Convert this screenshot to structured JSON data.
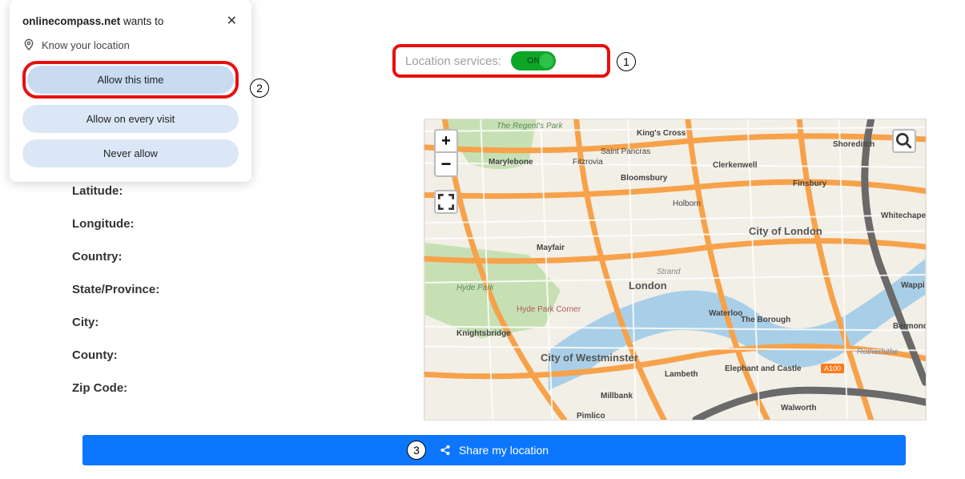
{
  "permission": {
    "site": "onlinecompass.net",
    "wants_to": "wants to",
    "know_location": "Know your location",
    "allow_this_time": "Allow this time",
    "allow_every_visit": "Allow on every visit",
    "never_allow": "Never allow"
  },
  "location_services": {
    "label": "Location services:",
    "state": "ON"
  },
  "info": {
    "latitude": "Latitude:",
    "longitude": "Longitude:",
    "country": "Country:",
    "state": "State/Province:",
    "city": "City:",
    "county": "County:",
    "zip": "Zip Code:"
  },
  "map": {
    "labels": {
      "regents_park": "The Regent's Park",
      "kings_cross": "King's Cross",
      "shoreditch": "Shoreditch",
      "st_pancras": "Saint Pancras",
      "marylebone": "Marylebone",
      "fitzrovia": "Fitzrovia",
      "bloomsbury": "Bloomsbury",
      "clerkenwell": "Clerkenwell",
      "finsbury": "Finsbury",
      "holborn": "Holborn",
      "whitechapel": "Whitechapel",
      "city_of_london": "City of London",
      "mayfair": "Mayfair",
      "strand": "Strand",
      "hyde_park": "Hyde Park",
      "london": "London",
      "wappi": "Wappi",
      "hyde_park_corner": "Hyde Park Corner",
      "knightsbridge": "Knightsbridge",
      "the_borough": "The Borough",
      "bermond": "Bermond",
      "city_of_westminster": "City of Westminster",
      "waterloo": "Waterloo",
      "rotherhithe": "Rotherhithe",
      "lambeth": "Lambeth",
      "elephant_castle": "Elephant and Castle",
      "millbank": "Millbank",
      "pimlico": "Pimlico",
      "walworth": "Walworth",
      "a100": "A100"
    }
  },
  "share": {
    "label": "Share my location"
  },
  "annotations": {
    "a1": "1",
    "a2": "2",
    "a3": "3"
  }
}
